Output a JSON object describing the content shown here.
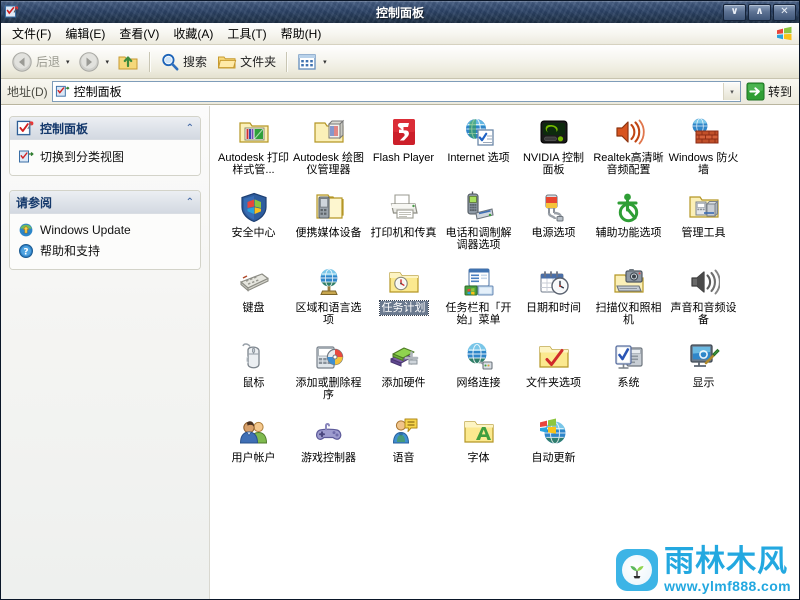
{
  "window": {
    "title": "控制面板",
    "sysicon": "control-panel-icon",
    "buttons": {
      "minimize": "∨",
      "maximize": "∧",
      "close": "✕"
    }
  },
  "menubar": {
    "items": [
      {
        "label": "文件(F)",
        "name": "menu-file"
      },
      {
        "label": "编辑(E)",
        "name": "menu-edit"
      },
      {
        "label": "查看(V)",
        "name": "menu-view"
      },
      {
        "label": "收藏(A)",
        "name": "menu-favorites"
      },
      {
        "label": "工具(T)",
        "name": "menu-tools"
      },
      {
        "label": "帮助(H)",
        "name": "menu-help"
      }
    ],
    "brand_icon": "windows-flag-icon"
  },
  "toolbar": {
    "back_label": "后退",
    "forward_label": "",
    "up_label": "",
    "search_label": "搜索",
    "folders_label": "文件夹",
    "views_label": "",
    "dropdown_glyph": "▾"
  },
  "address": {
    "label": "地址(D)",
    "value": "控制面板",
    "icon": "control-panel-icon",
    "dropdown_glyph": "▾",
    "go_label": "转到"
  },
  "sidebar": {
    "panels": [
      {
        "title": "控制面板",
        "name": "panel-control-panel",
        "icon": "control-panel-icon",
        "chevron": "⌃",
        "links": [
          {
            "label": "切换到分类视图",
            "icon": "switch-view-icon",
            "name": "link-switch-category-view"
          }
        ]
      },
      {
        "title": "请参阅",
        "name": "panel-see-also",
        "icon": "",
        "chevron": "⌃",
        "links": [
          {
            "label": "Windows Update",
            "icon": "windows-update-icon",
            "name": "link-windows-update"
          },
          {
            "label": "帮助和支持",
            "icon": "help-support-icon",
            "name": "link-help-and-support"
          }
        ]
      }
    ]
  },
  "content": {
    "selected_index": 16,
    "items": [
      {
        "label": "Autodesk 打印样式管...",
        "icon": "autodesk-plot-style-icon",
        "name": "item-autodesk-plot-style-manager"
      },
      {
        "label": "Autodesk 绘图仪管理器",
        "icon": "autodesk-plotter-icon",
        "name": "item-autodesk-plotter-manager"
      },
      {
        "label": "Flash Player",
        "icon": "flash-player-icon",
        "name": "item-flash-player"
      },
      {
        "label": "Internet 选项",
        "icon": "internet-options-icon",
        "name": "item-internet-options"
      },
      {
        "label": "NVIDIA 控制面板",
        "icon": "nvidia-control-panel-icon",
        "name": "item-nvidia-control-panel"
      },
      {
        "label": "Realtek高清晰音频配置",
        "icon": "realtek-audio-icon",
        "name": "item-realtek-hd-audio"
      },
      {
        "label": "Windows 防火墙",
        "icon": "windows-firewall-icon",
        "name": "item-windows-firewall"
      },
      {
        "label": "安全中心",
        "icon": "security-center-icon",
        "name": "item-security-center"
      },
      {
        "label": "便携媒体设备",
        "icon": "portable-media-devices-icon",
        "name": "item-portable-media-devices"
      },
      {
        "label": "打印机和传真",
        "icon": "printers-and-faxes-icon",
        "name": "item-printers-and-faxes"
      },
      {
        "label": "电话和调制解调器选项",
        "icon": "phone-and-modem-icon",
        "name": "item-phone-and-modem-options"
      },
      {
        "label": "电源选项",
        "icon": "power-options-icon",
        "name": "item-power-options"
      },
      {
        "label": "辅助功能选项",
        "icon": "accessibility-options-icon",
        "name": "item-accessibility-options"
      },
      {
        "label": "管理工具",
        "icon": "administrative-tools-icon",
        "name": "item-administrative-tools"
      },
      {
        "label": "键盘",
        "icon": "keyboard-icon",
        "name": "item-keyboard"
      },
      {
        "label": "区域和语言选项",
        "icon": "regional-language-icon",
        "name": "item-regional-and-language-options"
      },
      {
        "label": "任务计划",
        "icon": "scheduled-tasks-icon",
        "name": "item-scheduled-tasks"
      },
      {
        "label": "任务栏和「开始」菜单",
        "icon": "taskbar-start-menu-icon",
        "name": "item-taskbar-and-start-menu"
      },
      {
        "label": "日期和时间",
        "icon": "date-and-time-icon",
        "name": "item-date-and-time"
      },
      {
        "label": "扫描仪和照相机",
        "icon": "scanners-and-cameras-icon",
        "name": "item-scanners-and-cameras"
      },
      {
        "label": "声音和音频设备",
        "icon": "sounds-and-audio-icon",
        "name": "item-sounds-and-audio-devices"
      },
      {
        "label": "鼠标",
        "icon": "mouse-icon",
        "name": "item-mouse"
      },
      {
        "label": "添加或删除程序",
        "icon": "add-remove-programs-icon",
        "name": "item-add-or-remove-programs"
      },
      {
        "label": "添加硬件",
        "icon": "add-hardware-icon",
        "name": "item-add-hardware"
      },
      {
        "label": "网络连接",
        "icon": "network-connections-icon",
        "name": "item-network-connections"
      },
      {
        "label": "文件夹选项",
        "icon": "folder-options-icon",
        "name": "item-folder-options"
      },
      {
        "label": "系统",
        "icon": "system-icon",
        "name": "item-system"
      },
      {
        "label": "显示",
        "icon": "display-icon",
        "name": "item-display"
      },
      {
        "label": "用户帐户",
        "icon": "user-accounts-icon",
        "name": "item-user-accounts"
      },
      {
        "label": "游戏控制器",
        "icon": "game-controllers-icon",
        "name": "item-game-controllers"
      },
      {
        "label": "语音",
        "icon": "speech-icon",
        "name": "item-speech"
      },
      {
        "label": "字体",
        "icon": "fonts-icon",
        "name": "item-fonts"
      },
      {
        "label": "自动更新",
        "icon": "automatic-updates-icon",
        "name": "item-automatic-updates"
      }
    ]
  },
  "watermark": {
    "brand": "雨林木风",
    "url": "www.ylmf888.com",
    "color": "#23a8e0"
  },
  "colors": {
    "titlebar": "#2b4265",
    "selection": "#6b7a8f",
    "panel_title": "#14386b",
    "accent": "#23a8e0"
  }
}
